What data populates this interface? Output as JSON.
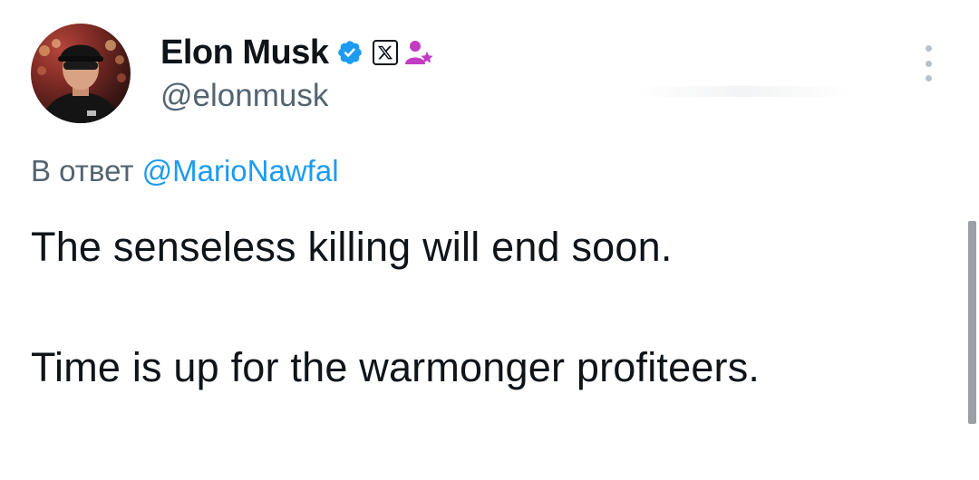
{
  "author": {
    "display_name": "Elon Musk",
    "handle": "@elonmusk",
    "verified_icon": "verified-badge-icon",
    "affiliate_icon": "x-logo-icon",
    "subscription_icon": "person-star-icon",
    "colors": {
      "verified": "#1d9bf0",
      "subscription": "#c23bc2"
    }
  },
  "reply": {
    "prefix": "В ответ",
    "to_handle": "@MarioNawfal"
  },
  "tweet": {
    "line1": "The senseless killing will end soon.",
    "line2": "Time is up for the warmonger profiteers."
  },
  "menu": {
    "icon": "more-options-icon"
  }
}
